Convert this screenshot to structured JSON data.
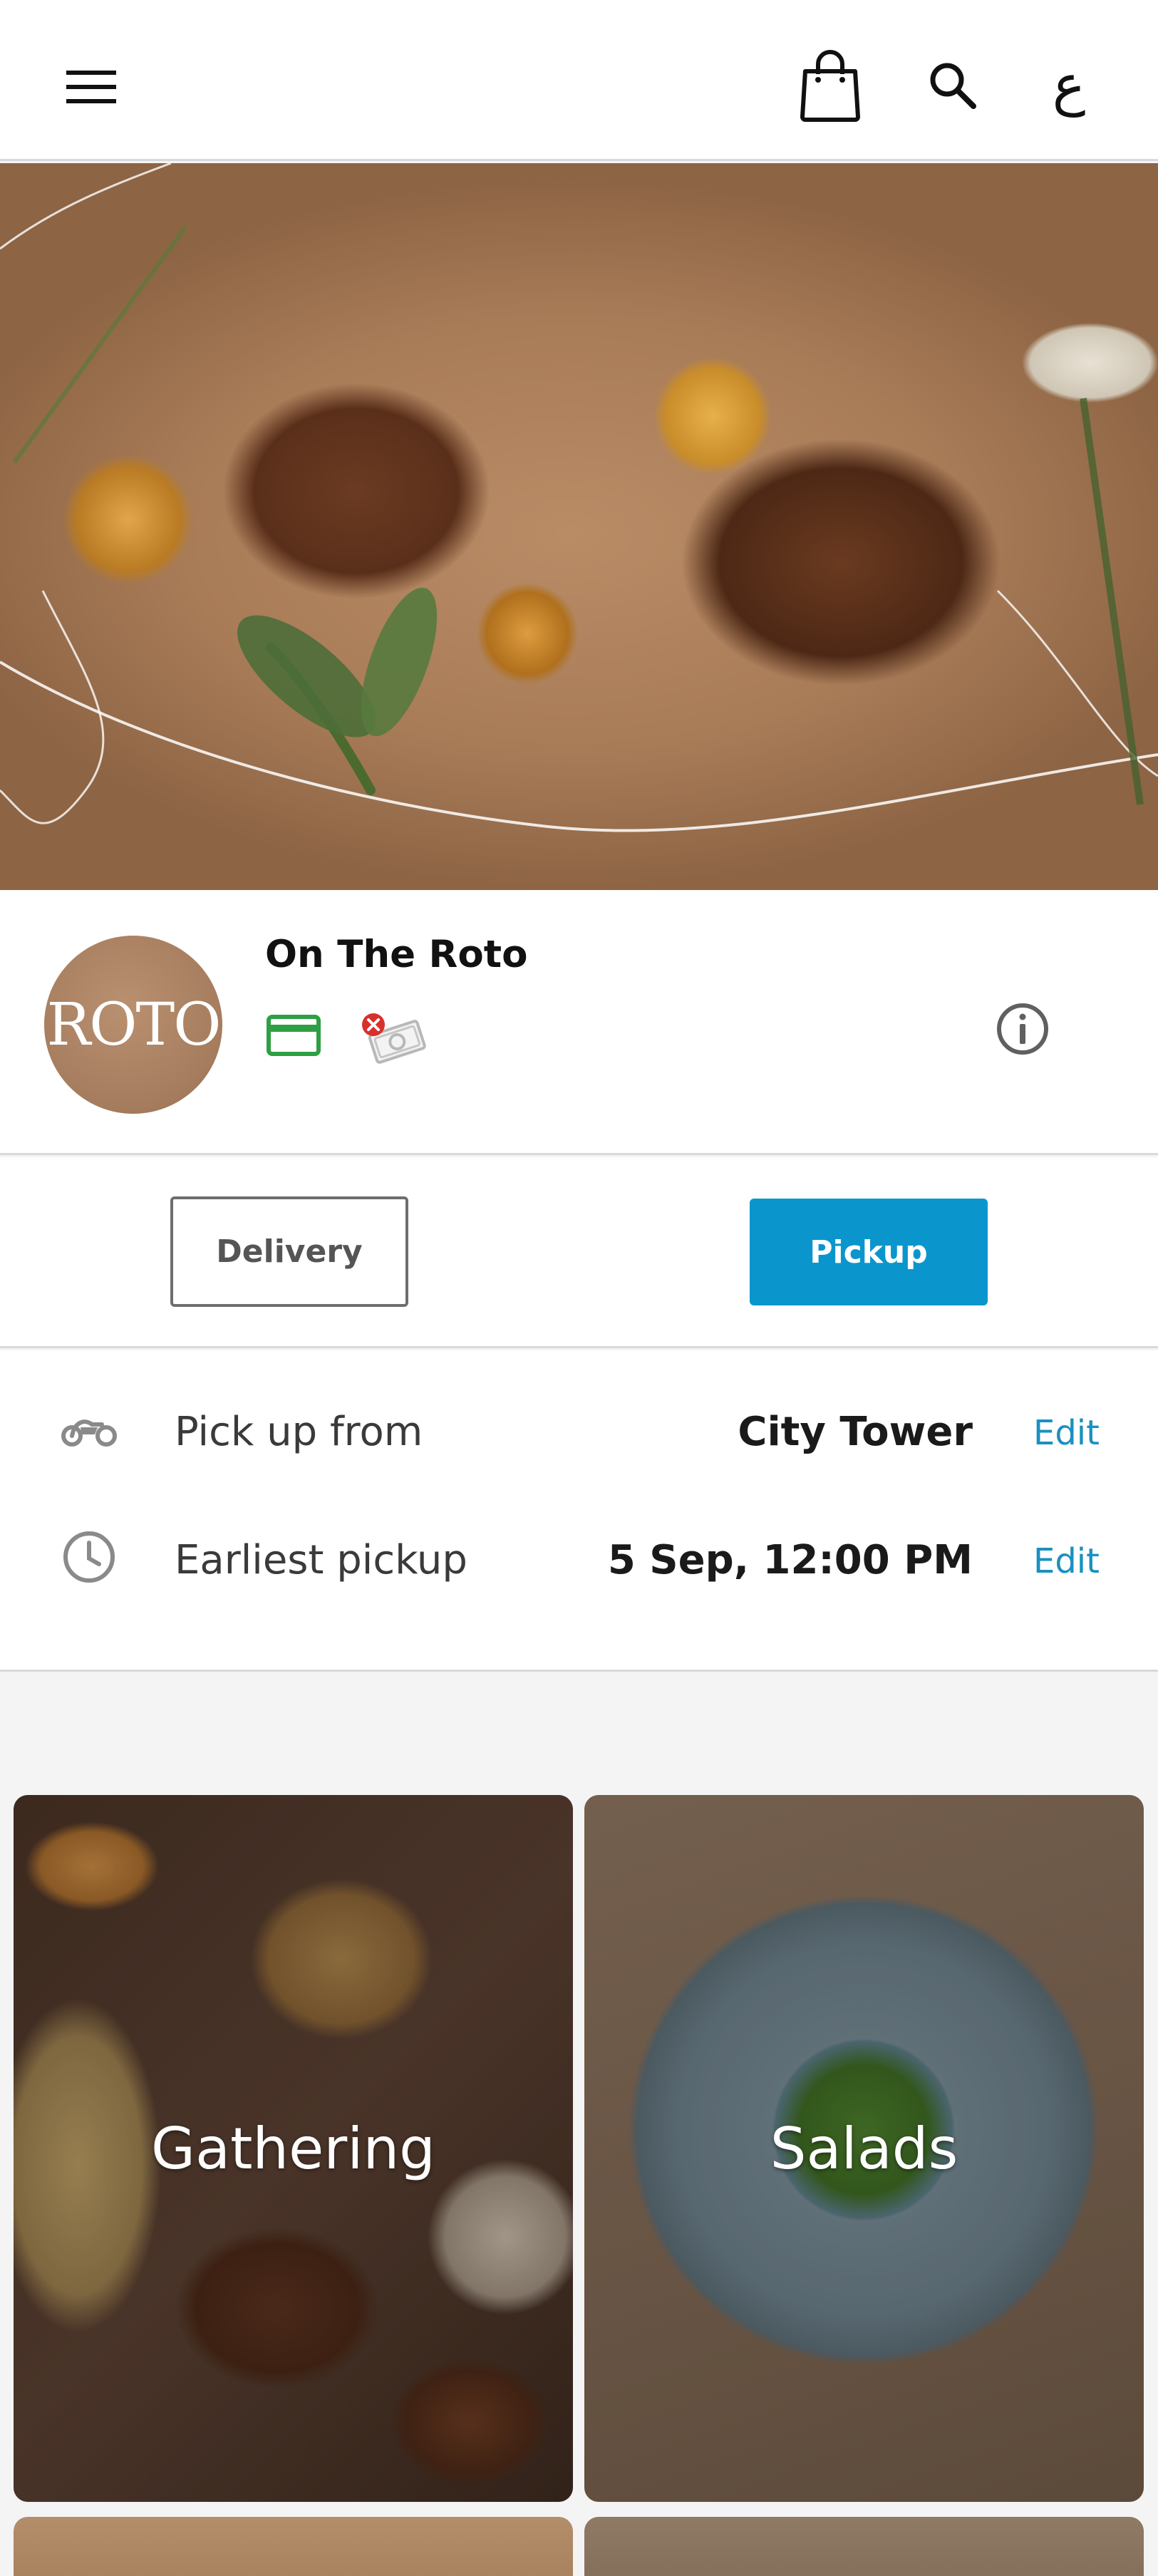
{
  "header": {
    "language_toggle": "ع",
    "icons": [
      "menu-icon",
      "shopping-bag-icon",
      "search-icon"
    ]
  },
  "restaurant": {
    "name": "On The Roto",
    "logo_text": "ROTO",
    "payment_icons": [
      "credit-card-icon",
      "cash-unavailable-icon"
    ],
    "colors": {
      "card_icon": "#2ea043",
      "cash_unavailable_badge": "#d9302c"
    }
  },
  "order_mode": {
    "delivery_label": "Delivery",
    "pickup_label": "Pickup",
    "selected": "Pickup",
    "colors": {
      "selected_bg": "#0a96cc"
    }
  },
  "pickup_info": {
    "location_label": "Pick up from",
    "location_value": "City Tower",
    "time_label": "Earliest pickup",
    "time_value": "5 Sep, 12:00 PM",
    "edit_label": "Edit"
  },
  "categories": [
    {
      "label": "Gathering"
    },
    {
      "label": "Salads"
    }
  ]
}
